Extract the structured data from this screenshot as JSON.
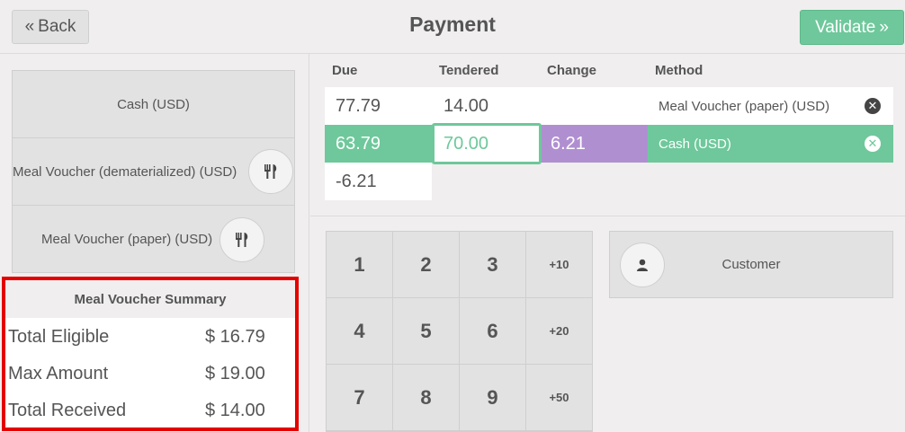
{
  "header": {
    "back_label": "Back",
    "back_icon": "double-chevron-left-icon",
    "title": "Payment",
    "validate_label": "Validate",
    "validate_icon": "double-chevron-right-icon"
  },
  "payment_methods": [
    {
      "label": "Cash (USD)",
      "icon": ""
    },
    {
      "label": "Meal Voucher (dematerialized) (USD)",
      "icon": "fork-knife-icon"
    },
    {
      "label": "Meal Voucher (paper) (USD)",
      "icon": "fork-knife-icon"
    }
  ],
  "summary": {
    "title": "Meal Voucher Summary",
    "rows": [
      {
        "label": "Total Eligible",
        "value": "$ 16.79"
      },
      {
        "label": "Max Amount",
        "value": "$ 19.00"
      },
      {
        "label": "Total Received",
        "value": "$ 14.00"
      }
    ]
  },
  "lines": {
    "headers": {
      "due": "Due",
      "tendered": "Tendered",
      "change": "Change",
      "method": "Method"
    },
    "rows": [
      {
        "due": "77.79",
        "tendered": "14.00",
        "change": "",
        "method": "Meal Voucher (paper) (USD)"
      },
      {
        "due": "63.79",
        "tendered": "70.00",
        "change": "6.21",
        "method": "Cash (USD)"
      }
    ],
    "remaining_due": "-6.21"
  },
  "numpad": [
    "1",
    "2",
    "3",
    "+10",
    "4",
    "5",
    "6",
    "+20",
    "7",
    "8",
    "9",
    "+50"
  ],
  "customer": {
    "label": "Customer",
    "icon": "user-icon"
  },
  "colors": {
    "accent": "#6ec89b",
    "change": "#b08fd1",
    "highlight": "#e50000"
  }
}
